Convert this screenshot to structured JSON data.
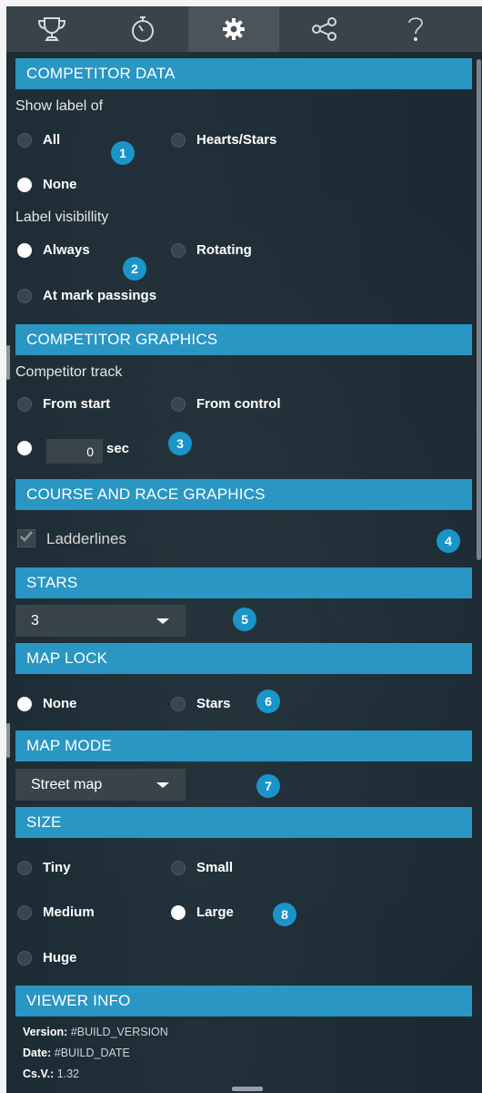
{
  "tabs": [
    {
      "name": "trophy-icon"
    },
    {
      "name": "stopwatch-icon"
    },
    {
      "name": "gear-icon",
      "active": true
    },
    {
      "name": "share-icon"
    },
    {
      "name": "help-icon"
    }
  ],
  "competitor_data": {
    "title": "COMPETITOR DATA",
    "show_label_of": "Show label of",
    "label_options": {
      "all": "All",
      "hearts_stars": "Hearts/Stars",
      "none": "None",
      "selected": "None"
    },
    "label_visibility": "Label visibillity",
    "visibility_options": {
      "always": "Always",
      "rotating": "Rotating",
      "at_mark_passings": "At mark passings",
      "selected": "Always"
    }
  },
  "competitor_graphics": {
    "title": "COMPETITOR GRAPHICS",
    "competitor_track": "Competitor track",
    "options": {
      "from_start": "From start",
      "from_control": "From control"
    },
    "seconds_value": "0",
    "seconds_unit": "sec"
  },
  "course_race_graphics": {
    "title": "COURSE AND RACE GRAPHICS",
    "ladderlines": "Ladderlines",
    "ladderlines_checked": true
  },
  "stars": {
    "title": "STARS",
    "value": "3"
  },
  "map_lock": {
    "title": "MAP LOCK",
    "none": "None",
    "stars": "Stars",
    "selected": "None"
  },
  "map_mode": {
    "title": "MAP MODE",
    "value": "Street map"
  },
  "size": {
    "title": "SIZE",
    "tiny": "Tiny",
    "small": "Small",
    "medium": "Medium",
    "large": "Large",
    "huge": "Huge",
    "selected": "Large"
  },
  "viewer_info": {
    "title": "VIEWER INFO",
    "version_label": "Version:",
    "version_value": "#BUILD_VERSION",
    "date_label": "Date:",
    "date_value": "#BUILD_DATE",
    "csv_label": "Cs.V.:",
    "csv_value": "1.32"
  },
  "badges": [
    "1",
    "2",
    "3",
    "4",
    "5",
    "6",
    "7",
    "8"
  ],
  "colors": {
    "section_header": "#2996c4",
    "badge": "#1a94c9",
    "panel_bg": "#1b2a33",
    "tabbar_bg": "#38434a"
  }
}
